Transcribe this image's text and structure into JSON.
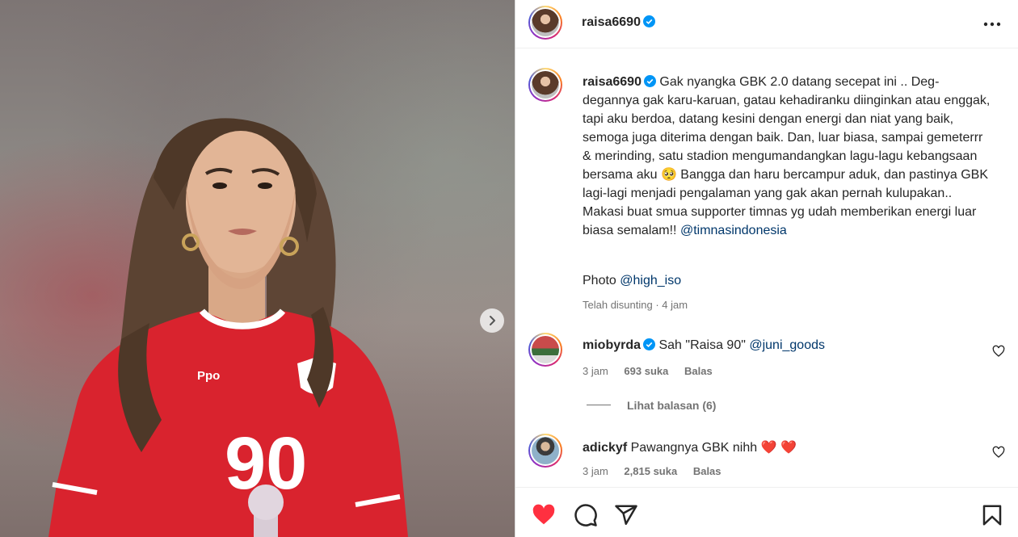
{
  "post": {
    "username": "raisa6690",
    "verified": true,
    "more_icon": "more-horizontal-icon",
    "caption_text": "Gak nyangka GBK 2.0 datang secepat ini .. Deg-degannya gak karu-karuan, gatau kehadiranku diinginkan atau enggak, tapi aku berdoa, datang kesini dengan energi dan niat yang baik, semoga juga diterima dengan baik. Dan, luar biasa, sampai gemeterrr & merinding, satu stadion mengumandangkan lagu-lagu kebangsaan bersama aku 🥺 Bangga dan haru bercampur aduk, dan pastinya GBK lagi-lagi menjadi pengalaman yang gak akan pernah kulupakan.. Makasi buat smua supporter timnas yg udah memberikan energi luar biasa semalam!!",
    "caption_mention": "@timnasindonesia",
    "photo_credit_label": "Photo",
    "photo_credit_mention": "@high_iso",
    "edited_label": "Telah disunting",
    "time_ago": "4 jam"
  },
  "photo": {
    "jersey_number": "90",
    "next_icon": "chevron-right-icon"
  },
  "comments": [
    {
      "username": "miobyrda",
      "verified": true,
      "text": "Sah \"Raisa 90\"",
      "mention": "@juni_goods",
      "time": "3 jam",
      "likes": "693 suka",
      "reply_label": "Balas"
    },
    {
      "username": "adickyf",
      "verified": false,
      "text": "Pawangnya GBK nihh",
      "emoji": "❤️ ❤️",
      "time": "3 jam",
      "likes": "2,815 suka",
      "reply_label": "Balas"
    }
  ],
  "view_replies_label": "Lihat balasan (6)",
  "actions": {
    "like_icon": "heart-filled-icon",
    "comment_icon": "comment-icon",
    "share_icon": "share-icon",
    "save_icon": "bookmark-icon"
  },
  "colors": {
    "like_red": "#ff3040",
    "link_blue": "#00376b",
    "verified_blue": "#0095f6",
    "muted_text": "#737373"
  }
}
